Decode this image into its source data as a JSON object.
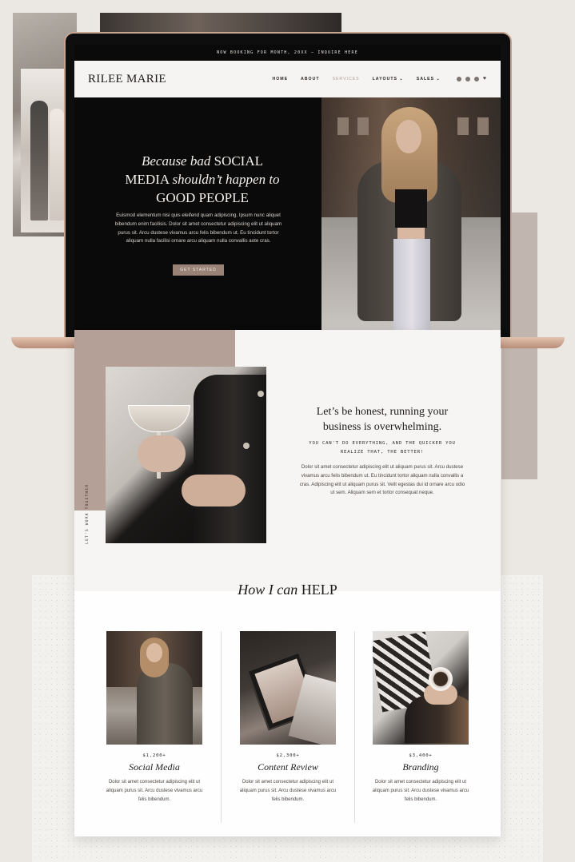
{
  "colors": {
    "page_bg": "#ebe7e3",
    "hero_bg": "#0b0a0a",
    "accent_taupe": "#b4a096",
    "button": "#9a8276",
    "laptop_frame": "#c8a592"
  },
  "topbar": {
    "announcement": "NOW BOOKING FOR MONTH, 20XX — INQUIRE HERE"
  },
  "header": {
    "logo": "RILEE MARIE",
    "nav": {
      "home": "HOME",
      "about": "ABOUT",
      "services": "SERVICES",
      "layouts": "LAYOUTS ⌄",
      "sales": "SALES ⌄"
    },
    "socials": [
      "facebook-icon",
      "pinterest-icon",
      "instagram-icon",
      "heart-icon"
    ]
  },
  "hero": {
    "title_part1": "Because bad",
    "title_part2": "SOCIAL",
    "title_part3": "MEDIA",
    "title_part4": "shouldn’t happen to",
    "title_part5": "GOOD PEOPLE",
    "body": "Euismod elementum nisi quis eleifend quam adipiscing. Ipsum nunc aliquet bibendum enim facilisis. Dolor sit amet consectetur adipiscing elit ut aliquam purus sit. Arcu dustese vivamus arcu felis bibendum ut. Eu tincidunt tortor aliquam nulla facilisi ornare arcu aliquam nulla convallis aote cras.",
    "cta": "GET STARTED"
  },
  "intro": {
    "side_label": "LET'S WORK TOGETHER",
    "title": "Let’s be honest, running your business is overwhelming.",
    "subtitle": "YOU CAN'T DO EVERYTHING, AND THE QUICKER YOU REALIZE THAT, THE BETTER!",
    "body": "Dolor sit amet consectetur adipiscing elit ut aliquam purus sit. Arcu dustese vivamus arcu felis bibendum ut. Eu tincidunt tortor aliquam nulla convallis a cras. Adipiscing elit ut aliquam purus sit. Velit egestas dui id ornare arcu odio ut sem. Aliquam sem et tortor consequat neque."
  },
  "help": {
    "title_italic": "How I can",
    "title_caps": "HELP",
    "cards": [
      {
        "price": "$1,200+",
        "name": "Social Media",
        "desc": "Dolor sit amet consectetur adipiscing elit ut aliquam purus sit. Arcu dustese vivamus arcu felis bibendum."
      },
      {
        "price": "$2,300+",
        "name": "Content Review",
        "desc": "Dolor sit amet consectetur adipiscing elit ut aliquam purus sit. Arcu dustese vivamus arcu felis bibendum."
      },
      {
        "price": "$3,400+",
        "name": "Branding",
        "desc": "Dolor sit amet consectetur adipiscing elit ut aliquam purus sit. Arcu dustese vivamus arcu felis bibendum."
      }
    ]
  }
}
